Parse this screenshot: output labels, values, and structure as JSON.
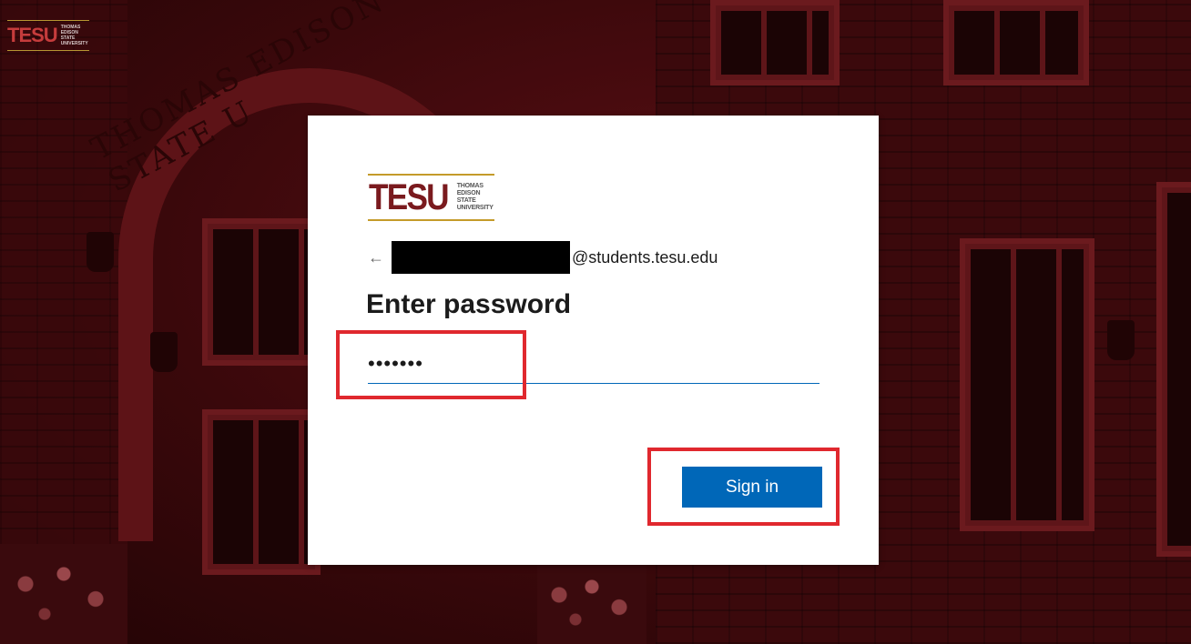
{
  "corner_logo": {
    "wordmark": "TESU",
    "line1": "THOMAS",
    "line2": "EDISON",
    "line3": "STATE",
    "line4": "UNIVERSITY"
  },
  "background": {
    "arch_inscription": "THOMAS EDISON STATE U"
  },
  "card": {
    "logo": {
      "wordmark": "TESU",
      "line1": "THOMAS",
      "line2": "EDISON",
      "line3": "STATE",
      "line4": "UNIVERSITY"
    },
    "back_arrow": "←",
    "email_suffix": "@students.tesu.edu",
    "title": "Enter password",
    "password_value": "•••••••",
    "sign_in_label": "Sign in"
  },
  "colors": {
    "primary_button": "#0067b8",
    "annotation": "#e0282e",
    "brand_maroon": "#7a1a1e",
    "brand_gold": "#c49b2a"
  }
}
